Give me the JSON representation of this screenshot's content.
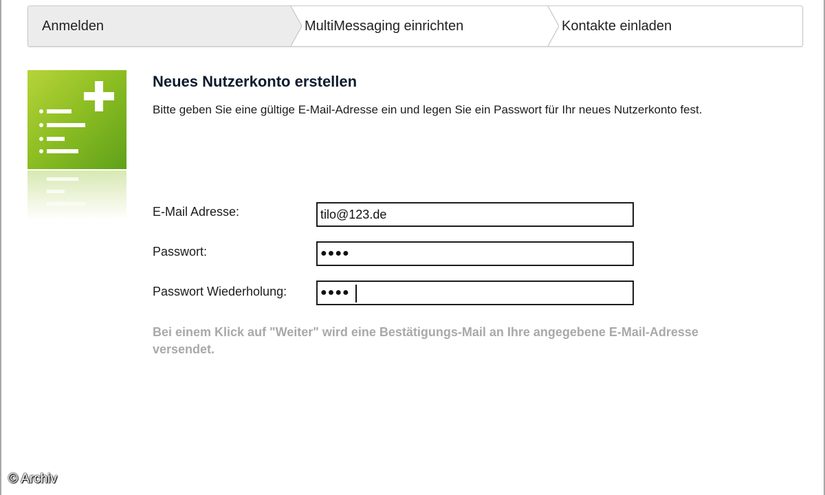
{
  "wizard": {
    "steps": [
      {
        "label": "Anmelden",
        "active": true
      },
      {
        "label": "MultiMessaging einrichten",
        "active": false
      },
      {
        "label": "Kontakte einladen",
        "active": false
      }
    ]
  },
  "icon": {
    "name": "add-account-icon",
    "color": "#8fbf23"
  },
  "form": {
    "title": "Neues Nutzerkonto erstellen",
    "description": "Bitte geben Sie eine gültige E-Mail-Adresse ein und legen Sie ein Passwort für Ihr neues Nutzerkonto fest.",
    "email": {
      "label": "E-Mail Adresse:",
      "value": "tilo@123.de"
    },
    "password": {
      "label": "Passwort:",
      "value": "●●●●"
    },
    "password_repeat": {
      "label": "Passwort Wiederholung:",
      "value": "●●●●"
    },
    "note": "Bei einem Klick auf \"Weiter\" wird eine Bestätigungs-Mail an Ihre angegebene E-Mail-Adresse versendet."
  },
  "watermark": {
    "text": "© Archiv"
  }
}
